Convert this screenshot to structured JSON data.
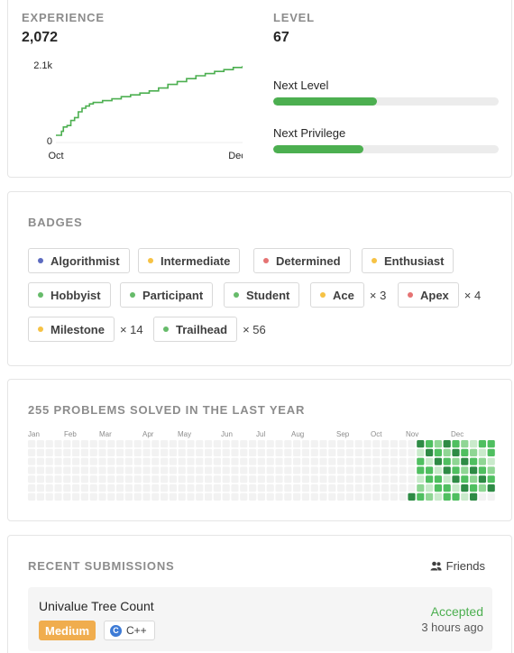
{
  "stats": {
    "experience_label": "Experience",
    "experience_value": "2,072",
    "level_label": "Level",
    "level_value": "67",
    "next_level_label": "Next Level",
    "next_level_progress": 0.46,
    "next_privilege_label": "Next Privilege",
    "next_privilege_progress": 0.4,
    "accent_color": "#4caf50"
  },
  "chart_data": {
    "type": "line",
    "x_ticks": [
      "Oct",
      "Dec"
    ],
    "y_ticks": [
      "0",
      "2.1k"
    ],
    "ylim": [
      0,
      2100
    ],
    "x": [
      0,
      3,
      4,
      6,
      8,
      10,
      12,
      14,
      16,
      18,
      20,
      25,
      30,
      35,
      40,
      45,
      50,
      55,
      60,
      65,
      70,
      75,
      80,
      85,
      90,
      95,
      100
    ],
    "values": [
      150,
      260,
      380,
      420,
      560,
      640,
      800,
      900,
      960,
      1020,
      1060,
      1110,
      1160,
      1220,
      1270,
      1320,
      1380,
      1460,
      1560,
      1640,
      1720,
      1800,
      1860,
      1920,
      1970,
      2030,
      2072
    ]
  },
  "badges": {
    "title": "Badges",
    "items": [
      {
        "label": "Algorithmist",
        "color": "#5c6bc0",
        "count": ""
      },
      {
        "label": "Intermediate",
        "color": "#f6c244",
        "count": ""
      },
      {
        "label": "Determined",
        "color": "#e57373",
        "count": ""
      },
      {
        "label": "Enthusiast",
        "color": "#f6c244",
        "count": ""
      },
      {
        "label": "Hobbyist",
        "color": "#66bb6a",
        "count": ""
      },
      {
        "label": "Participant",
        "color": "#66bb6a",
        "count": ""
      },
      {
        "label": "Student",
        "color": "#66bb6a",
        "count": ""
      },
      {
        "label": "Ace",
        "color": "#f6c244",
        "count": "× 3"
      },
      {
        "label": "Apex",
        "color": "#e57373",
        "count": "× 4"
      },
      {
        "label": "Milestone",
        "color": "#f6c244",
        "count": "× 14"
      },
      {
        "label": "Trailhead",
        "color": "#66bb6a",
        "count": "× 56"
      }
    ]
  },
  "heatmap": {
    "title": "255 Problems Solved in the Last Year",
    "months": [
      "Jan",
      "Feb",
      "Mar",
      "Apr",
      "May",
      "Jun",
      "Jul",
      "Aug",
      "Sep",
      "Oct",
      "Nov",
      "Dec"
    ],
    "empty_color": "#f2f2f2",
    "active_colors": [
      "#c9eacb",
      "#8fd694",
      "#4fbf60",
      "#2e8b45"
    ]
  },
  "submissions": {
    "title": "Recent Submissions",
    "friends_label": "Friends",
    "items": [
      {
        "title": "Univalue Tree Count",
        "difficulty": "Medium",
        "language": "C++",
        "status": "Accepted",
        "time": "3 hours ago"
      }
    ]
  }
}
